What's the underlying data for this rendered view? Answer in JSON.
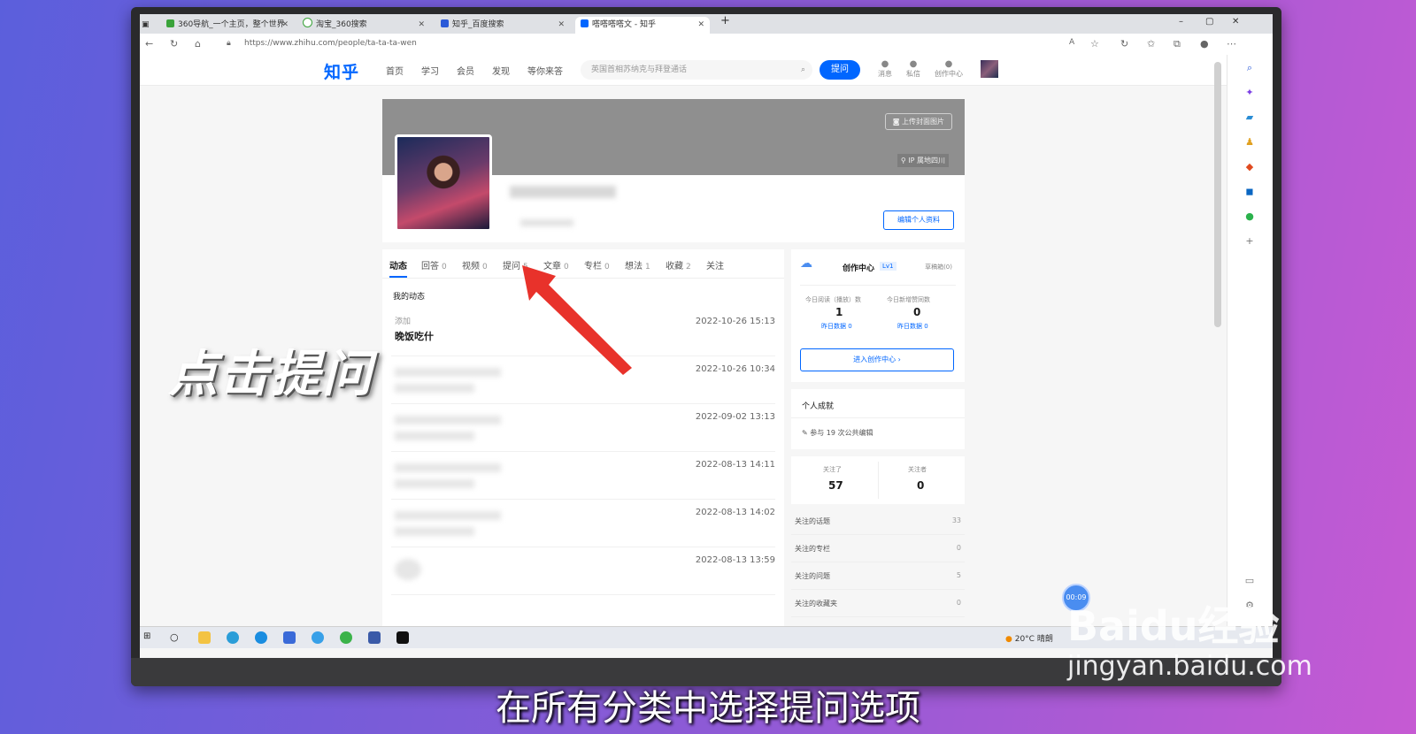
{
  "browser": {
    "tabs": [
      {
        "label": "360导航_一个主页，整个世界",
        "color": "#3aa33a"
      },
      {
        "label": "淘宝_360搜索",
        "color": "#3aa33a"
      },
      {
        "label": "知乎_百度搜索",
        "color": "#2b5ad8"
      },
      {
        "label": "嗒嗒嗒嗒文 - 知乎",
        "color": "#0066ff"
      }
    ],
    "new_tab": "+",
    "window_controls": [
      "–",
      "▢",
      "✕"
    ],
    "url": "https://www.zhihu.com/people/ta-ta-ta-wen"
  },
  "zhihu": {
    "logo": "知乎",
    "nav": [
      "首页",
      "学习",
      "会员",
      "发现",
      "等你来答"
    ],
    "search_placeholder": "英国首相苏纳克与拜登通话",
    "ask_button": "提问",
    "header_icons": [
      "消息",
      "私信",
      "创作中心"
    ],
    "upload_cover": "上传封面图片",
    "ip_location": "IP 属地四川",
    "edit_profile": "编辑个人资料",
    "tabs": [
      {
        "label": "动态",
        "count": ""
      },
      {
        "label": "回答",
        "count": "0"
      },
      {
        "label": "视频",
        "count": "0"
      },
      {
        "label": "提问",
        "count": "5"
      },
      {
        "label": "文章",
        "count": "0"
      },
      {
        "label": "专栏",
        "count": "0"
      },
      {
        "label": "想法",
        "count": "1"
      },
      {
        "label": "收藏",
        "count": "2"
      },
      {
        "label": "关注",
        "count": ""
      }
    ],
    "my_activity": "我的动态",
    "feed": [
      {
        "date": "2022-10-26 15:13",
        "prefix": "添加",
        "title": "晚饭吃什"
      },
      {
        "date": "2022-10-26 10:34"
      },
      {
        "date": "2022-09-02 13:13"
      },
      {
        "date": "2022-08-13 14:11"
      },
      {
        "date": "2022-08-13 14:02"
      },
      {
        "date": "2022-08-13 13:59"
      }
    ],
    "creator": {
      "title": "创作中心",
      "level": "Lv1",
      "drafts": "草稿箱(0)",
      "today_reads_label": "今日阅读（播放）数",
      "today_reads": "1",
      "yesterday_reads": "昨日数据 0",
      "today_likes_label": "今日新增赞同数",
      "today_likes": "0",
      "yesterday_likes": "昨日数据 0",
      "enter": "进入创作中心 ›"
    },
    "achievement": {
      "title": "个人成就",
      "item": "参与 19 次公共编辑"
    },
    "follow": {
      "following_label": "关注了",
      "following": "57",
      "followers_label": "关注者",
      "followers": "0"
    },
    "follow_list": [
      {
        "label": "关注的话题",
        "value": "33"
      },
      {
        "label": "关注的专栏",
        "value": "0"
      },
      {
        "label": "关注的问题",
        "value": "5"
      },
      {
        "label": "关注的收藏夹",
        "value": "0"
      }
    ]
  },
  "taskbar": {
    "weather": "20°C 晴朗"
  },
  "timer": "00:09",
  "overlay_text": "点击提问",
  "subtitle": "在所有分类中选择提问选项",
  "watermark": {
    "main": "Baidu经验",
    "sub": "jingyan.baidu.com"
  }
}
